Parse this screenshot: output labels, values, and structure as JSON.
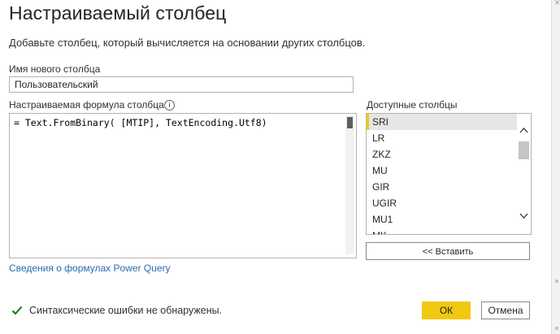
{
  "dialog": {
    "title": "Настраиваемый столбец",
    "subtitle": "Добавьте столбец, который вычисляется на основании других столбцов.",
    "close_glyph": "×"
  },
  "new_column": {
    "label": "Имя нового столбца",
    "value": "Пользовательский"
  },
  "formula": {
    "label": "Настраиваемая формула столбца",
    "info_glyph": "i",
    "text": "= Text.FromBinary( [MTIP], TextEncoding.Utf8)"
  },
  "available_columns": {
    "label": "Доступные столбцы",
    "items": [
      "SRI",
      "LR",
      "ZKZ",
      "MU",
      "GIR",
      "UGIR",
      "MU1",
      "MK"
    ],
    "selected": "SRI"
  },
  "insert_button": "<< Вставить",
  "help_link": "Сведения о формулах Power Query",
  "status": "Синтаксические ошибки не обнаружены.",
  "ok_button": "ОК",
  "cancel_button": "Отмена",
  "colors": {
    "accent": "#f2c811",
    "link": "#2b6cb0",
    "success": "#107c10"
  }
}
